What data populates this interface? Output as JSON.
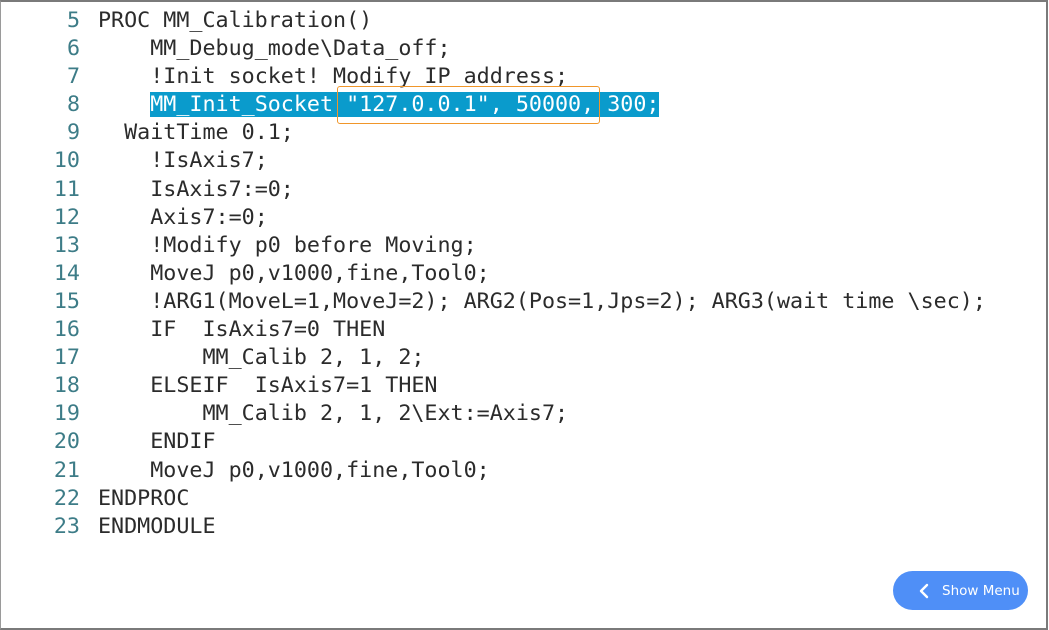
{
  "code": {
    "lines": [
      {
        "num": "5",
        "indent": "",
        "text": "PROC MM_Calibration()"
      },
      {
        "num": "6",
        "indent": "    ",
        "text": "MM_Debug_mode\\Data_off;"
      },
      {
        "num": "7",
        "indent": "    ",
        "text": "!Init socket! Modify IP address;"
      },
      {
        "num": "8",
        "indent": "    ",
        "text": "MM_Init_Socket \"127.0.0.1\", 50000, 300;",
        "highlighted": true
      },
      {
        "num": "9",
        "indent": "  ",
        "text": "WaitTime 0.1;"
      },
      {
        "num": "10",
        "indent": "    ",
        "text": "!IsAxis7;"
      },
      {
        "num": "11",
        "indent": "    ",
        "text": "IsAxis7:=0;"
      },
      {
        "num": "12",
        "indent": "    ",
        "text": "Axis7:=0;"
      },
      {
        "num": "13",
        "indent": "    ",
        "text": "!Modify p0 before Moving;"
      },
      {
        "num": "14",
        "indent": "    ",
        "text": "MoveJ p0,v1000,fine,Tool0;"
      },
      {
        "num": "15",
        "indent": "    ",
        "text": "!ARG1(MoveL=1,MoveJ=2); ARG2(Pos=1,Jps=2); ARG3(wait time \\sec);"
      },
      {
        "num": "16",
        "indent": "    ",
        "text": "IF  IsAxis7=0 THEN"
      },
      {
        "num": "17",
        "indent": "        ",
        "text": "MM_Calib 2, 1, 2;"
      },
      {
        "num": "18",
        "indent": "    ",
        "text": "ELSEIF  IsAxis7=1 THEN"
      },
      {
        "num": "19",
        "indent": "        ",
        "text": "MM_Calib 2, 1, 2\\Ext:=Axis7;"
      },
      {
        "num": "20",
        "indent": "    ",
        "text": "ENDIF"
      },
      {
        "num": "21",
        "indent": "    ",
        "text": "MoveJ p0,v1000,fine,Tool0;"
      },
      {
        "num": "22",
        "indent": "",
        "text": "ENDPROC"
      },
      {
        "num": "23",
        "indent": "",
        "text": "ENDMODULE"
      }
    ],
    "highlight_color": "#0a9bcc",
    "annotation_box_color": "#f0962a"
  },
  "show_menu": {
    "label": "Show Menu",
    "icon": "chevron-left-icon",
    "color": "#4f8ff7"
  }
}
